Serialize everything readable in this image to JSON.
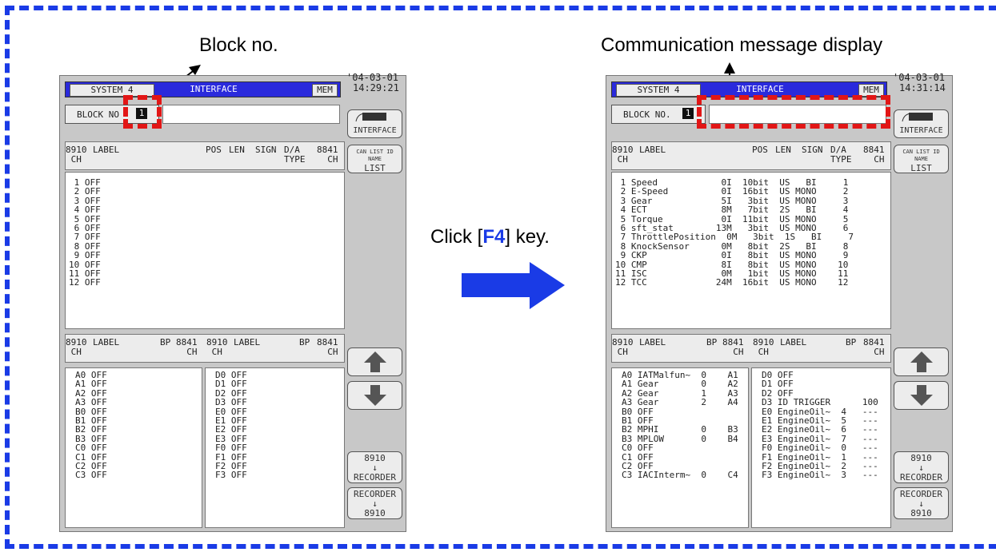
{
  "callouts": {
    "block_no": "Block no.",
    "comm_msg": "Communication message display"
  },
  "instruction": {
    "prefix": "Click [",
    "key": "F4",
    "suffix": "] key."
  },
  "left": {
    "sys": "SYSTEM 4",
    "title": "INTERFACE",
    "mem": "MEM",
    "date": "'04-03-01",
    "time": "14:29:21",
    "block_label": "BLOCK NO",
    "block_num": "1",
    "hdr_ch": "8910\n CH",
    "hdr_label": "LABEL",
    "hdr_pos": "POS",
    "hdr_len": "LEN",
    "hdr_sign": "SIGN",
    "hdr_da": "D/A\nTYPE",
    "hdr_8841": "8841\n  CH",
    "rows": [
      " 1 OFF",
      " 2 OFF",
      " 3 OFF",
      " 4 OFF",
      " 5 OFF",
      " 6 OFF",
      " 7 OFF",
      " 8 OFF",
      " 9 OFF",
      "10 OFF",
      "11 OFF",
      "12 OFF"
    ],
    "bhdr_ch": "8910\n CH",
    "bhdr_label": "LABEL",
    "bhdr_bp": "BP",
    "bhdr_8841": "8841\n  CH",
    "lower_left": [
      "A0 OFF",
      "A1 OFF",
      "A2 OFF",
      "A3 OFF",
      "B0 OFF",
      "B1 OFF",
      "B2 OFF",
      "B3 OFF",
      "C0 OFF",
      "C1 OFF",
      "C2 OFF",
      "C3 OFF"
    ],
    "lower_right": [
      "D0 OFF",
      "D1 OFF",
      "D2 OFF",
      "D3 OFF",
      "E0 OFF",
      "E1 OFF",
      "E2 OFF",
      "E3 OFF",
      "F0 OFF",
      "F1 OFF",
      "F2 OFF",
      "F3 OFF"
    ]
  },
  "right": {
    "sys": "SYSTEM 4",
    "title": "INTERFACE",
    "mem": "MEM",
    "date": "'04-03-01",
    "time": "14:31:14",
    "block_label": "BLOCK NO.",
    "block_num": "1",
    "rows": [
      " 1 Speed            0I  10bit  US   BI     1",
      " 2 E-Speed          0I  16bit  US MONO     2",
      " 3 Gear             5I   3bit  US MONO     3",
      " 4 ECT              8M   7bit  2S   BI     4",
      " 5 Torque           0I  11bit  US MONO     5",
      " 6 sft_stat        13M   3bit  US MONO     6",
      " 7 ThrottlePosition  0M   3bit  1S   BI     7",
      " 8 KnockSensor      0M   8bit  2S   BI     8",
      " 9 CKP              0I   8bit  US MONO     9",
      "10 CMP              8I   8bit  US MONO    10",
      "11 ISC              0M   1bit  US MONO    11",
      "12 TCC             24M  16bit  US MONO    12"
    ],
    "lower_left": [
      "A0 IATMalfun~  0    A1",
      "A1 Gear        0    A2",
      "A2 Gear        1    A3",
      "A3 Gear        2    A4",
      "B0 OFF",
      "B1 OFF",
      "B2 MPHI        0    B3",
      "B3 MPLOW       0    B4",
      "C0 OFF",
      "C1 OFF",
      "C2 OFF",
      "C3 IACInterm~  0    C4"
    ],
    "lower_right": [
      "D0 OFF",
      "D1 OFF",
      "D2 OFF",
      "D3 ID TRIGGER      100",
      "E0 EngineOil~  4   ---",
      "E1 EngineOil~  5   ---",
      "E2 EngineOil~  6   ---",
      "E3 EngineOil~  7   ---",
      "F0 EngineOil~  0   ---",
      "F1 EngineOil~  1   ---",
      "F2 EngineOil~  2   ---",
      "F3 EngineOil~  3   ---"
    ]
  },
  "buttons": {
    "interface": "INTERFACE",
    "list": "LIST",
    "can_list": "CAN LIST",
    "id_name": "ID NAME",
    "to_rec_top": "8910",
    "to_rec_bot": "RECORDER",
    "from_rec_top": "RECORDER",
    "from_rec_bot": "8910"
  },
  "colors": {
    "frame": "#1a3be6",
    "highlight": "#e21616",
    "titlebar": "#2a2adc",
    "arrow": "#1a3be6"
  }
}
